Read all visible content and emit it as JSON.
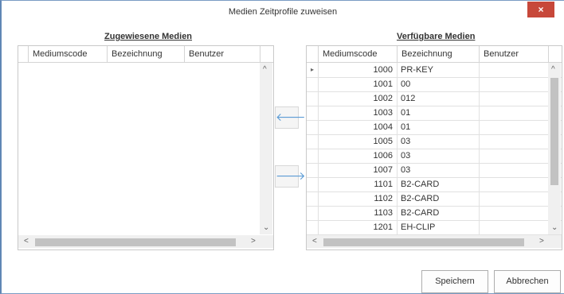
{
  "window": {
    "title": "Medien Zeitprofile zuweisen",
    "close_label": "×"
  },
  "left": {
    "title": "Zugewiesene Medien",
    "columns": [
      "Mediumscode",
      "Bezeichnung",
      "Benutzer"
    ]
  },
  "right": {
    "title": "Verfügbare Medien",
    "columns": [
      "Mediumscode",
      "Bezeichnung",
      "Benutzer"
    ],
    "rows": [
      {
        "code": "1000",
        "name": "PR-KEY",
        "user": ""
      },
      {
        "code": "1001",
        "name": "00",
        "user": ""
      },
      {
        "code": "1002",
        "name": "012",
        "user": ""
      },
      {
        "code": "1003",
        "name": "01",
        "user": ""
      },
      {
        "code": "1004",
        "name": "01",
        "user": ""
      },
      {
        "code": "1005",
        "name": "03",
        "user": ""
      },
      {
        "code": "1006",
        "name": "03",
        "user": ""
      },
      {
        "code": "1007",
        "name": "03",
        "user": ""
      },
      {
        "code": "1101",
        "name": "B2-CARD",
        "user": ""
      },
      {
        "code": "1102",
        "name": "B2-CARD",
        "user": ""
      },
      {
        "code": "1103",
        "name": "B2-CARD",
        "user": ""
      },
      {
        "code": "1201",
        "name": "EH-CLIP",
        "user": ""
      }
    ]
  },
  "transfer": {
    "to_left_icon": "arrow-left-icon",
    "to_right_icon": "arrow-right-icon",
    "to_left_glyph": "🡐",
    "to_right_glyph": "🡒"
  },
  "buttons": {
    "save": "Speichern",
    "cancel": "Abbrechen"
  },
  "colors": {
    "accent": "#5b9bd5",
    "close_bg": "#c7483a"
  }
}
